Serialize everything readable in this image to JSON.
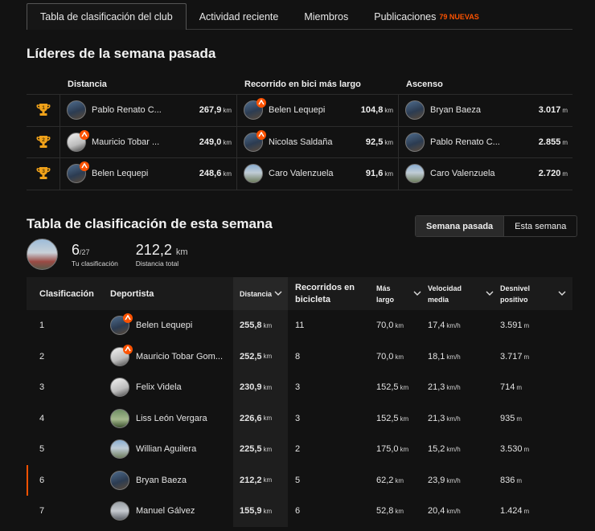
{
  "tabs": [
    {
      "label": "Tabla de clasificación del club",
      "active": true
    },
    {
      "label": "Actividad reciente"
    },
    {
      "label": "Miembros"
    },
    {
      "label": "Publicaciones",
      "badge": "79 NUEVAS"
    }
  ],
  "leaders": {
    "title": "Líderes de la semana pasada",
    "headers": [
      "Distancia",
      "Recorrido en bici más largo",
      "Ascenso"
    ],
    "rows": [
      {
        "place": "1",
        "distance": {
          "name": "Pablo Renato C...",
          "value": "267,9",
          "unit": "km"
        },
        "longest": {
          "name": "Belen Lequepi",
          "value": "104,8",
          "unit": "km"
        },
        "climb": {
          "name": "Bryan Baeza",
          "value": "3.017",
          "unit": "m"
        }
      },
      {
        "place": "2",
        "distance": {
          "name": "Mauricio Tobar ...",
          "value": "249,0",
          "unit": "km"
        },
        "longest": {
          "name": "Nicolas Saldaña",
          "value": "92,5",
          "unit": "km"
        },
        "climb": {
          "name": "Pablo Renato C...",
          "value": "2.855",
          "unit": "m"
        }
      },
      {
        "place": "3",
        "distance": {
          "name": "Belen Lequepi",
          "value": "248,6",
          "unit": "km"
        },
        "longest": {
          "name": "Caro Valenzuela",
          "value": "91,6",
          "unit": "km"
        },
        "climb": {
          "name": "Caro Valenzuela",
          "value": "2.720",
          "unit": "m"
        }
      }
    ]
  },
  "this_week": {
    "title": "Tabla de clasificación de esta semana",
    "toggle": {
      "last": "Semana pasada",
      "this": "Esta semana"
    },
    "my_rank": "6",
    "my_rank_total": "/27",
    "my_rank_label": "Tu clasificación",
    "total_distance": "212,2",
    "total_distance_unit": "km",
    "total_distance_label": "Distancia total"
  },
  "table": {
    "headers": {
      "rank": "Clasificación",
      "athlete": "Deportista",
      "distance": "Distancia",
      "rides": "Recorridos en bicicleta",
      "longest": "Más largo",
      "speed": "Velocidad media",
      "elevation": "Desnivel positivo"
    },
    "rows": [
      {
        "rank": "1",
        "name": "Belen Lequepi",
        "distance": "255,8",
        "rides": "11",
        "longest": "70,0",
        "speed": "17,4",
        "elevation": "3.591"
      },
      {
        "rank": "2",
        "name": "Mauricio Tobar Gom...",
        "distance": "252,5",
        "rides": "8",
        "longest": "70,0",
        "speed": "18,1",
        "elevation": "3.717"
      },
      {
        "rank": "3",
        "name": "Felix Videla",
        "distance": "230,9",
        "rides": "3",
        "longest": "152,5",
        "speed": "21,3",
        "elevation": "714"
      },
      {
        "rank": "4",
        "name": "Liss León Vergara",
        "distance": "226,6",
        "rides": "3",
        "longest": "152,5",
        "speed": "21,3",
        "elevation": "935"
      },
      {
        "rank": "5",
        "name": "Willian Aguilera",
        "distance": "225,5",
        "rides": "2",
        "longest": "175,0",
        "speed": "15,2",
        "elevation": "3.530"
      },
      {
        "rank": "6",
        "name": "Bryan Baeza",
        "distance": "212,2",
        "rides": "5",
        "longest": "62,2",
        "speed": "23,9",
        "elevation": "836"
      },
      {
        "rank": "7",
        "name": "Manuel Gálvez",
        "distance": "155,9",
        "rides": "6",
        "longest": "52,8",
        "speed": "20,4",
        "elevation": "1.424"
      }
    ]
  },
  "units": {
    "km": "km",
    "m": "m",
    "kmh": "km/h"
  },
  "colors": {
    "accent": "#fc5200",
    "gold": "#f0a21a",
    "background": "#121212"
  }
}
